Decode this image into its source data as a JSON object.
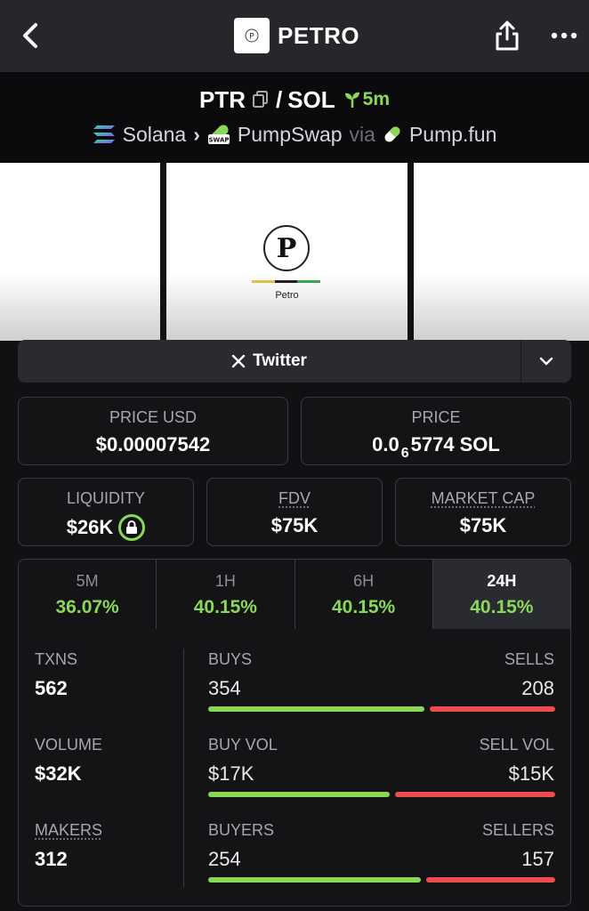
{
  "header": {
    "title": "PETRO",
    "logo_text": "P"
  },
  "pair": {
    "base": "PTR",
    "separator": "/",
    "quote": "SOL",
    "age": "5m"
  },
  "route": {
    "chain": "Solana",
    "dex": "PumpSwap",
    "dex_badge": "SWAP",
    "via": "via",
    "launchpad": "Pump.fun"
  },
  "banner": {
    "logo_letter": "P",
    "word": "Petro"
  },
  "social": {
    "twitter_label": "Twitter"
  },
  "price_usd": {
    "label": "PRICE USD",
    "value": "$0.00007542"
  },
  "price_native": {
    "label": "PRICE",
    "prefix": "0.0",
    "zeros": "6",
    "digits": "5774",
    "unit": "SOL"
  },
  "liquidity": {
    "label": "LIQUIDITY",
    "value": "$26K"
  },
  "fdv": {
    "label": "FDV",
    "value": "$75K"
  },
  "market_cap": {
    "label": "MARKET CAP",
    "value": "$75K"
  },
  "timeframes": [
    {
      "label": "5M",
      "change": "36.07%"
    },
    {
      "label": "1H",
      "change": "40.15%"
    },
    {
      "label": "6H",
      "change": "40.15%"
    },
    {
      "label": "24H",
      "change": "40.15%"
    }
  ],
  "stats": {
    "txns": {
      "label": "TXNS",
      "value": "562",
      "left_label": "BUYS",
      "left_value": "354",
      "right_label": "SELLS",
      "right_value": "208",
      "ratio": 0.63
    },
    "volume": {
      "label": "VOLUME",
      "value": "$32K",
      "left_label": "BUY VOL",
      "left_value": "$17K",
      "right_label": "SELL VOL",
      "right_value": "$15K",
      "ratio": 0.53
    },
    "makers": {
      "label": "MAKERS",
      "value": "312",
      "left_label": "BUYERS",
      "left_value": "254",
      "right_label": "SELLERS",
      "right_value": "157",
      "ratio": 0.62
    }
  },
  "colors": {
    "accent_green": "#8ad85a",
    "sell_red": "#ef4d4d",
    "background": "#111114"
  }
}
